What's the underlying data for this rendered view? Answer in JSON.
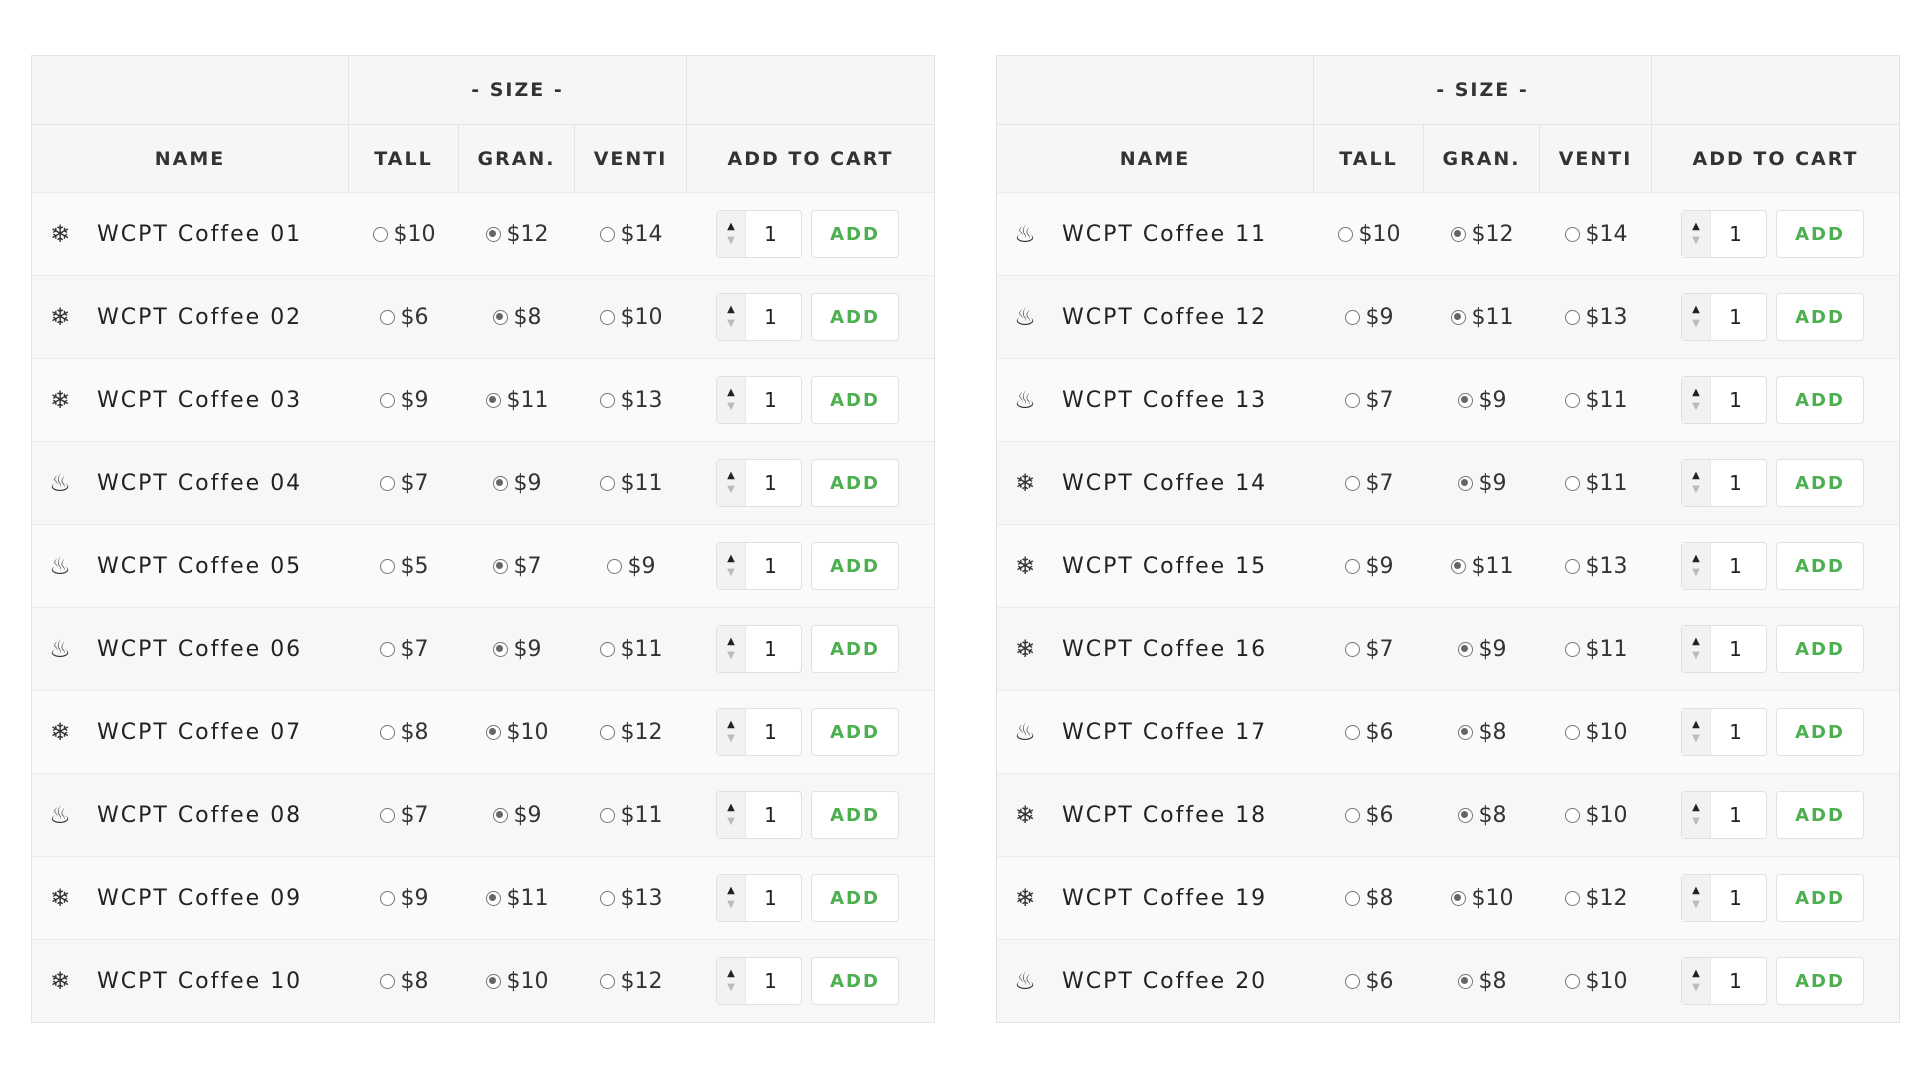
{
  "accent_color": "#4caf50",
  "headers": {
    "size_group": "- SIZE -",
    "name": "NAME",
    "tall": "TALL",
    "grande": "GRAN.",
    "venti": "VENTI",
    "add_to_cart": "ADD TO CART"
  },
  "add_label": "ADD",
  "icons": {
    "cold": "snowflake-icon",
    "hot": "steam-icon"
  },
  "tables": [
    {
      "rows": [
        {
          "type": "cold",
          "name": "WCPT Coffee 01",
          "prices": [
            "$10",
            "$12",
            "$14"
          ],
          "selected": 1,
          "qty": "1"
        },
        {
          "type": "cold",
          "name": "WCPT Coffee 02",
          "prices": [
            "$6",
            "$8",
            "$10"
          ],
          "selected": 1,
          "qty": "1"
        },
        {
          "type": "cold",
          "name": "WCPT Coffee 03",
          "prices": [
            "$9",
            "$11",
            "$13"
          ],
          "selected": 1,
          "qty": "1"
        },
        {
          "type": "hot",
          "name": "WCPT Coffee 04",
          "prices": [
            "$7",
            "$9",
            "$11"
          ],
          "selected": 1,
          "qty": "1"
        },
        {
          "type": "hot",
          "name": "WCPT Coffee 05",
          "prices": [
            "$5",
            "$7",
            "$9"
          ],
          "selected": 1,
          "qty": "1"
        },
        {
          "type": "hot",
          "name": "WCPT Coffee 06",
          "prices": [
            "$7",
            "$9",
            "$11"
          ],
          "selected": 1,
          "qty": "1"
        },
        {
          "type": "cold",
          "name": "WCPT Coffee 07",
          "prices": [
            "$8",
            "$10",
            "$12"
          ],
          "selected": 1,
          "qty": "1"
        },
        {
          "type": "hot",
          "name": "WCPT Coffee 08",
          "prices": [
            "$7",
            "$9",
            "$11"
          ],
          "selected": 1,
          "qty": "1"
        },
        {
          "type": "cold",
          "name": "WCPT Coffee 09",
          "prices": [
            "$9",
            "$11",
            "$13"
          ],
          "selected": 1,
          "qty": "1"
        },
        {
          "type": "cold",
          "name": "WCPT Coffee 10",
          "prices": [
            "$8",
            "$10",
            "$12"
          ],
          "selected": 1,
          "qty": "1"
        }
      ]
    },
    {
      "rows": [
        {
          "type": "hot",
          "name": "WCPT Coffee 11",
          "prices": [
            "$10",
            "$12",
            "$14"
          ],
          "selected": 1,
          "qty": "1"
        },
        {
          "type": "hot",
          "name": "WCPT Coffee 12",
          "prices": [
            "$9",
            "$11",
            "$13"
          ],
          "selected": 1,
          "qty": "1"
        },
        {
          "type": "hot",
          "name": "WCPT Coffee 13",
          "prices": [
            "$7",
            "$9",
            "$11"
          ],
          "selected": 1,
          "qty": "1"
        },
        {
          "type": "cold",
          "name": "WCPT Coffee 14",
          "prices": [
            "$7",
            "$9",
            "$11"
          ],
          "selected": 1,
          "qty": "1"
        },
        {
          "type": "cold",
          "name": "WCPT Coffee 15",
          "prices": [
            "$9",
            "$11",
            "$13"
          ],
          "selected": 1,
          "qty": "1"
        },
        {
          "type": "cold",
          "name": "WCPT Coffee 16",
          "prices": [
            "$7",
            "$9",
            "$11"
          ],
          "selected": 1,
          "qty": "1"
        },
        {
          "type": "hot",
          "name": "WCPT Coffee 17",
          "prices": [
            "$6",
            "$8",
            "$10"
          ],
          "selected": 1,
          "qty": "1"
        },
        {
          "type": "cold",
          "name": "WCPT Coffee 18",
          "prices": [
            "$6",
            "$8",
            "$10"
          ],
          "selected": 1,
          "qty": "1"
        },
        {
          "type": "cold",
          "name": "WCPT Coffee 19",
          "prices": [
            "$8",
            "$10",
            "$12"
          ],
          "selected": 1,
          "qty": "1"
        },
        {
          "type": "hot",
          "name": "WCPT Coffee 20",
          "prices": [
            "$6",
            "$8",
            "$10"
          ],
          "selected": 1,
          "qty": "1"
        }
      ]
    }
  ]
}
